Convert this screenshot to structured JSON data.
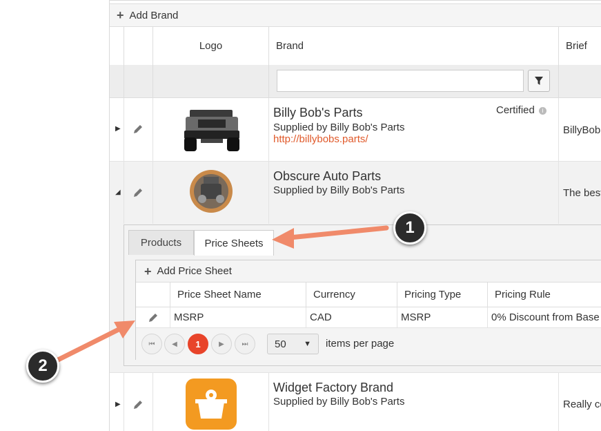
{
  "toolbar": {
    "add_brand_label": "Add Brand"
  },
  "columns": {
    "logo": "Logo",
    "brand": "Brand",
    "brief": "Brief"
  },
  "filter": {
    "value": ""
  },
  "rows": [
    {
      "name": "Billy Bob's Parts",
      "supplied": "Supplied by Billy Bob's Parts",
      "url": "http://billybobs.parts/",
      "certified": "Certified",
      "brief": "BillyBob"
    },
    {
      "name": "Obscure Auto Parts",
      "supplied": "Supplied by Billy Bob's Parts",
      "brief": "The best"
    },
    {
      "name": "Widget Factory Brand",
      "supplied": "Supplied by Billy Bob's Parts",
      "brief": "Really co"
    }
  ],
  "detail": {
    "tabs": [
      "Products",
      "Price Sheets"
    ],
    "active_tab": "Price Sheets",
    "add_price_sheet_label": "Add Price Sheet",
    "columns": [
      "Price Sheet Name",
      "Currency",
      "Pricing Type",
      "Pricing Rule"
    ],
    "rows": [
      {
        "name": "MSRP",
        "currency": "CAD",
        "pricing_type": "MSRP",
        "pricing_rule": "0% Discount from Base"
      }
    ],
    "pager": {
      "current_page": "1",
      "page_size": "50",
      "items_per_page_label": "items per page"
    }
  },
  "callouts": [
    "1",
    "2"
  ],
  "colors": {
    "accent": "#e8442a",
    "link": "#e05a2b",
    "arrow": "#f08a6a"
  }
}
